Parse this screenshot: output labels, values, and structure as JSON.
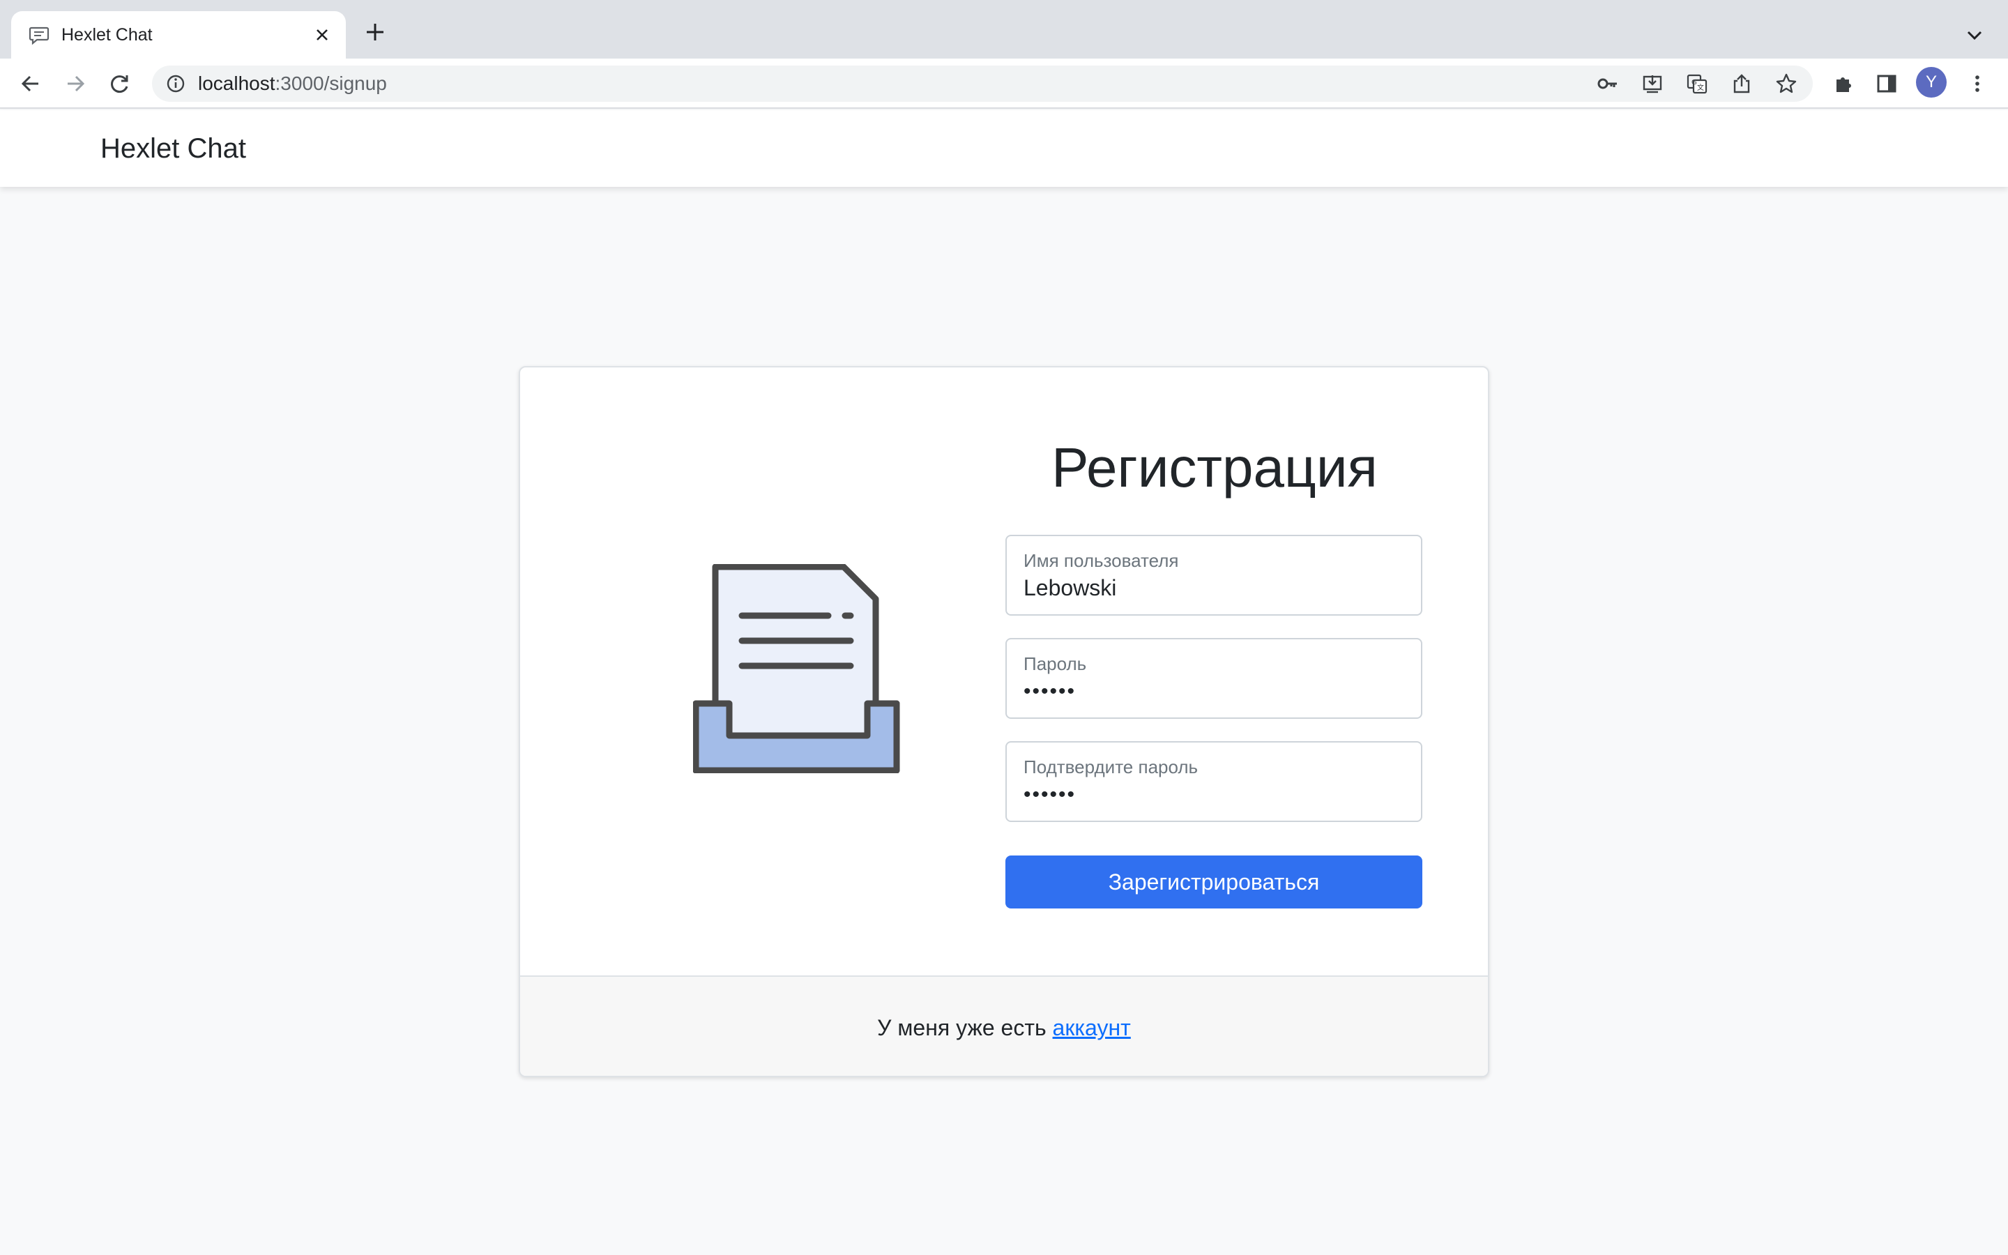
{
  "browser": {
    "tab_title": "Hexlet Chat",
    "url_host": "localhost",
    "url_rest": ":3000/signup",
    "profile_initial": "Y",
    "icons": [
      "chat-icon",
      "close-icon",
      "plus-icon",
      "chevron-down-icon",
      "back-icon",
      "forward-icon",
      "reload-icon",
      "info-icon",
      "key-icon",
      "install-icon",
      "translate-icon",
      "share-icon",
      "star-icon",
      "puzzle-icon",
      "sidepanel-icon",
      "menu-icon"
    ]
  },
  "navbar": {
    "brand": "Hexlet Chat"
  },
  "signup": {
    "title": "Регистрация",
    "username": {
      "label": "Имя пользователя",
      "value": "Lebowski"
    },
    "password": {
      "label": "Пароль",
      "value": "••••••"
    },
    "confirm": {
      "label": "Подтвердите пароль",
      "value": "••••••"
    },
    "submit_label": "Зарегистрироваться"
  },
  "footer": {
    "text": "У меня уже есть ",
    "link_text": "аккаунт"
  },
  "colors": {
    "primary": "#3070f0",
    "link": "#0d6efd",
    "page_bg": "#f8f9fa",
    "illustration_fill": "#a3bce8"
  }
}
